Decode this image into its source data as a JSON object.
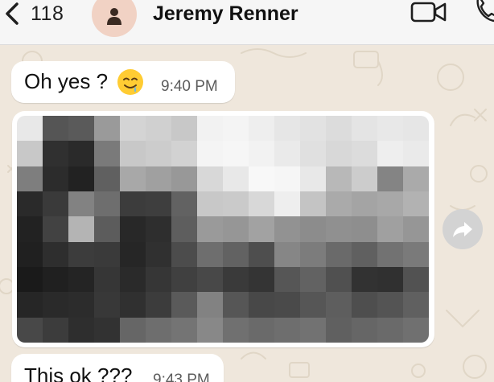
{
  "header": {
    "back_count": "118",
    "contact_name": "Jeremy Renner",
    "icons": [
      "back-chevron-icon",
      "person-icon",
      "video-call-icon",
      "phone-call-icon"
    ]
  },
  "messages": [
    {
      "text": "Oh yes ?",
      "emoji": "drooling-face-emoji",
      "time": "9:40 PM"
    },
    {
      "type": "image",
      "content": "pixelated-photo"
    },
    {
      "text": "This ok ???",
      "time": "9:43 PM"
    }
  ],
  "actions": {
    "forward_icon": "forward-arrow-icon"
  },
  "colors": {
    "background": "#efe7dc",
    "header": "#f6f6f6",
    "bubble": "#ffffff",
    "avatar": "#f1d2c4",
    "emoji": "#ffcc33"
  }
}
